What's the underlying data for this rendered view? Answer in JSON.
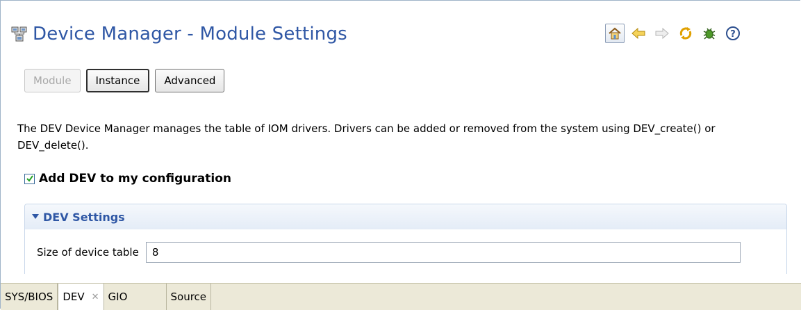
{
  "header": {
    "title": "Device Manager - Module Settings"
  },
  "toolbar": {
    "icons": [
      "home-icon",
      "back-icon",
      "forward-icon",
      "refresh-icon",
      "bug-icon",
      "help-icon"
    ]
  },
  "modes": {
    "module": "Module",
    "instance": "Instance",
    "advanced": "Advanced"
  },
  "description": "The DEV Device Manager manages the table of IOM drivers. Drivers can be added or removed from the system using DEV_create() or DEV_delete().",
  "enable": {
    "label": "Add DEV to my configuration",
    "checked": true
  },
  "section": {
    "title": "DEV Settings",
    "fields": {
      "size_label": "Size of device table",
      "size_value": "8"
    }
  },
  "bottom_tabs": [
    {
      "label": "SYS/BIOS"
    },
    {
      "label": "DEV"
    },
    {
      "label": "GIO"
    },
    {
      "label": "Source"
    }
  ],
  "colors": {
    "title": "#2f57a5",
    "tab_bar": "#ece9d8"
  }
}
